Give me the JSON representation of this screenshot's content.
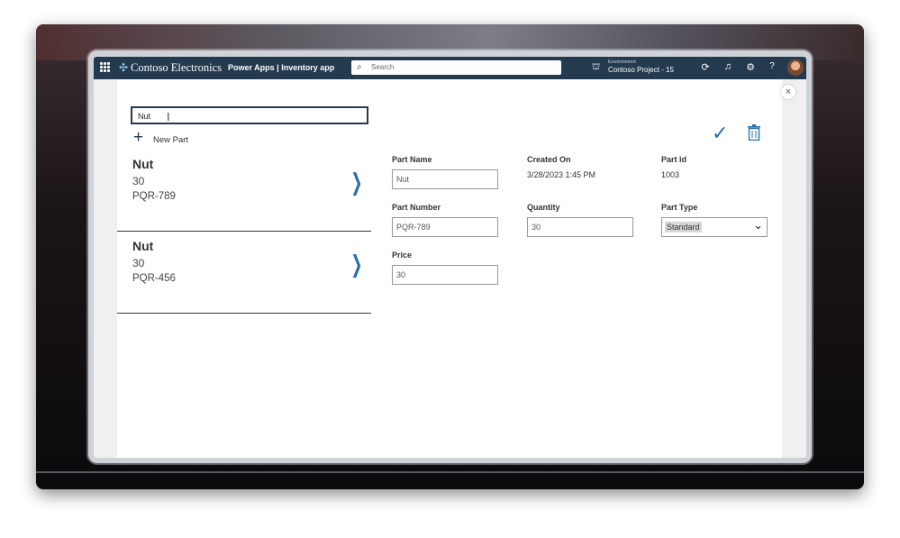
{
  "topbar": {
    "brand": "Contoso Electronics",
    "app_title": "Power Apps  |  Inventory app",
    "search_placeholder": "Search",
    "environment_label": "Environment",
    "environment_name": "Contoso Project - 15"
  },
  "list": {
    "filter_value": "Nut",
    "new_part_label": "New Part",
    "items": [
      {
        "name": "Nut",
        "quantity": "30",
        "part_number": "PQR-789"
      },
      {
        "name": "Nut",
        "quantity": "30",
        "part_number": "PQR-456"
      }
    ]
  },
  "form": {
    "part_name_label": "Part Name",
    "part_name_value": "Nut",
    "created_on_label": "Created On",
    "created_on_value": "3/28/2023 1:45 PM",
    "part_id_label": "Part Id",
    "part_id_value": "1003",
    "part_number_label": "Part Number",
    "part_number_value": "PQR-789",
    "quantity_label": "Quantity",
    "quantity_value": "30",
    "part_type_label": "Part Type",
    "part_type_value": "Standard",
    "price_label": "Price",
    "price_value": "30"
  },
  "colors": {
    "topbar": "#233a4f",
    "accent": "#2a6fa8"
  }
}
